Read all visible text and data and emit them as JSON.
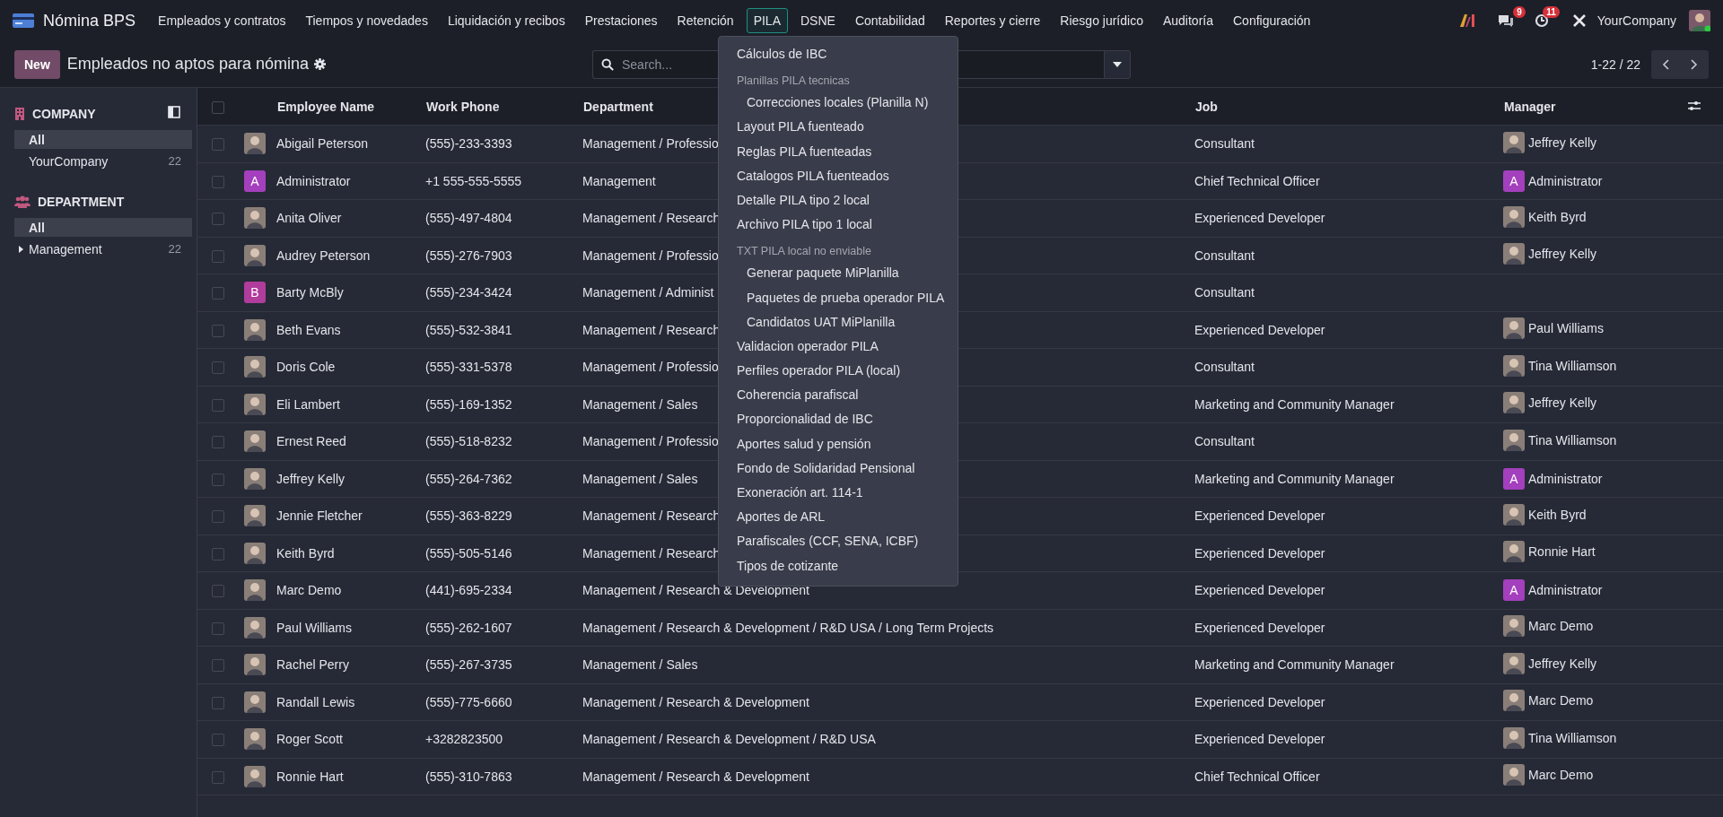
{
  "navbar": {
    "app_name": "Nómina BPS",
    "menus": [
      {
        "label": "Empleados y contratos",
        "selected": false
      },
      {
        "label": "Tiempos y novedades",
        "selected": false
      },
      {
        "label": "Liquidación y recibos",
        "selected": false
      },
      {
        "label": "Prestaciones",
        "selected": false
      },
      {
        "label": "Retención",
        "selected": false
      },
      {
        "label": "PILA",
        "selected": true
      },
      {
        "label": "DSNE",
        "selected": false
      },
      {
        "label": "Contabilidad",
        "selected": false
      },
      {
        "label": "Reportes y cierre",
        "selected": false
      },
      {
        "label": "Riesgo jurídico",
        "selected": false
      },
      {
        "label": "Auditoría",
        "selected": false
      },
      {
        "label": "Configuración",
        "selected": false
      }
    ],
    "chat_count": "9",
    "activity_count": "11",
    "company": "YourCompany"
  },
  "control_panel": {
    "new_button": "New",
    "title": "Empleados no aptos para nómina",
    "search_placeholder": "Search...",
    "pager": "1-22 / 22"
  },
  "dropdown": {
    "items": [
      {
        "kind": "item",
        "label": "Cálculos de IBC"
      },
      {
        "kind": "header",
        "label": "Planillas PILA tecnicas"
      },
      {
        "kind": "subitem",
        "label": "Correcciones locales (Planilla N)"
      },
      {
        "kind": "item",
        "label": "Layout PILA fuenteado"
      },
      {
        "kind": "item",
        "label": "Reglas PILA fuenteadas"
      },
      {
        "kind": "item",
        "label": "Catalogos PILA fuenteados"
      },
      {
        "kind": "item",
        "label": "Detalle PILA tipo 2 local"
      },
      {
        "kind": "item",
        "label": "Archivo PILA tipo 1 local"
      },
      {
        "kind": "header",
        "label": "TXT PILA local no enviable"
      },
      {
        "kind": "subitem",
        "label": "Generar paquete MiPlanilla"
      },
      {
        "kind": "subitem",
        "label": "Paquetes de prueba operador PILA"
      },
      {
        "kind": "subitem",
        "label": "Candidatos UAT MiPlanilla"
      },
      {
        "kind": "item",
        "label": "Validacion operador PILA"
      },
      {
        "kind": "item",
        "label": "Perfiles operador PILA (local)"
      },
      {
        "kind": "item",
        "label": "Coherencia parafiscal"
      },
      {
        "kind": "item",
        "label": "Proporcionalidad de IBC"
      },
      {
        "kind": "item",
        "label": "Aportes salud y pensión"
      },
      {
        "kind": "item",
        "label": "Fondo de Solidaridad Pensional"
      },
      {
        "kind": "item",
        "label": "Exoneración art. 114-1"
      },
      {
        "kind": "item",
        "label": "Aportes de ARL"
      },
      {
        "kind": "item",
        "label": "Parafiscales (CCF, SENA, ICBF)"
      },
      {
        "kind": "item",
        "label": "Tipos de cotizante"
      }
    ]
  },
  "sidebar": {
    "sections": [
      {
        "kind": "company",
        "title": "COMPANY",
        "items": [
          {
            "label": "All",
            "selected": true,
            "expandable": false
          },
          {
            "label": "YourCompany",
            "count": "22",
            "selected": false,
            "expandable": false
          }
        ]
      },
      {
        "kind": "department",
        "title": "DEPARTMENT",
        "items": [
          {
            "label": "All",
            "selected": true,
            "expandable": false
          },
          {
            "label": "Management",
            "count": "22",
            "selected": false,
            "expandable": true
          }
        ]
      }
    ]
  },
  "table": {
    "all_checked": false,
    "columns": [
      "Employee Name",
      "Work Phone",
      "Department",
      "Job",
      "Manager"
    ],
    "rows": [
      {
        "checked": false,
        "name": "Abigail Peterson",
        "avatar": {
          "kind": "photo"
        },
        "phone": "(555)-233-3393",
        "department": "Management / Professio",
        "job": "Consultant",
        "manager": {
          "name": "Jeffrey Kelly",
          "avatar": {
            "kind": "photo"
          }
        }
      },
      {
        "checked": false,
        "name": "Administrator",
        "avatar": {
          "kind": "letter",
          "letter": "A",
          "color": "#a43fbd"
        },
        "phone": "+1 555-555-5555",
        "department": "Management",
        "job": "Chief Technical Officer",
        "manager": {
          "name": "Administrator",
          "avatar": {
            "kind": "letter",
            "letter": "A",
            "color": "#a43fbd"
          }
        }
      },
      {
        "checked": false,
        "name": "Anita Oliver",
        "avatar": {
          "kind": "photo"
        },
        "phone": "(555)-497-4804",
        "department": "Management / Research",
        "job": "Experienced Developer",
        "manager": {
          "name": "Keith Byrd",
          "avatar": {
            "kind": "photo"
          }
        }
      },
      {
        "checked": false,
        "name": "Audrey Peterson",
        "avatar": {
          "kind": "photo"
        },
        "phone": "(555)-276-7903",
        "department": "Management / Professio",
        "job": "Consultant",
        "manager": {
          "name": "Jeffrey Kelly",
          "avatar": {
            "kind": "photo"
          }
        }
      },
      {
        "checked": false,
        "name": "Barty McBly",
        "avatar": {
          "kind": "letter",
          "letter": "B",
          "color": "#b03c9c"
        },
        "phone": "(555)-234-3424",
        "department": "Management / Administ",
        "job": "Consultant"
      },
      {
        "checked": false,
        "name": "Beth Evans",
        "avatar": {
          "kind": "photo"
        },
        "phone": "(555)-532-3841",
        "department": "Management / Research",
        "job": "Experienced Developer",
        "manager": {
          "name": "Paul Williams",
          "avatar": {
            "kind": "photo"
          }
        }
      },
      {
        "checked": false,
        "name": "Doris Cole",
        "avatar": {
          "kind": "photo"
        },
        "phone": "(555)-331-5378",
        "department": "Management / Professio",
        "job": "Consultant",
        "manager": {
          "name": "Tina Williamson",
          "avatar": {
            "kind": "photo"
          }
        }
      },
      {
        "checked": false,
        "name": "Eli Lambert",
        "avatar": {
          "kind": "photo"
        },
        "phone": "(555)-169-1352",
        "department": "Management / Sales",
        "job": "Marketing and Community Manager",
        "manager": {
          "name": "Jeffrey Kelly",
          "avatar": {
            "kind": "photo"
          }
        }
      },
      {
        "checked": false,
        "name": "Ernest Reed",
        "avatar": {
          "kind": "photo"
        },
        "phone": "(555)-518-8232",
        "department": "Management / Professio",
        "job": "Consultant",
        "manager": {
          "name": "Tina Williamson",
          "avatar": {
            "kind": "photo"
          }
        }
      },
      {
        "checked": false,
        "name": "Jeffrey Kelly",
        "avatar": {
          "kind": "photo"
        },
        "phone": "(555)-264-7362",
        "department": "Management / Sales",
        "job": "Marketing and Community Manager",
        "manager": {
          "name": "Administrator",
          "avatar": {
            "kind": "letter",
            "letter": "A",
            "color": "#a43fbd"
          }
        }
      },
      {
        "checked": false,
        "name": "Jennie Fletcher",
        "avatar": {
          "kind": "photo"
        },
        "phone": "(555)-363-8229",
        "department": "Management / Research",
        "job": "Experienced Developer",
        "manager": {
          "name": "Keith Byrd",
          "avatar": {
            "kind": "photo"
          }
        }
      },
      {
        "checked": false,
        "name": "Keith Byrd",
        "avatar": {
          "kind": "photo"
        },
        "phone": "(555)-505-5146",
        "department": "Management / Research",
        "job": "Experienced Developer",
        "manager": {
          "name": "Ronnie Hart",
          "avatar": {
            "kind": "photo"
          }
        }
      },
      {
        "checked": false,
        "name": "Marc Demo",
        "avatar": {
          "kind": "photo"
        },
        "phone": "(441)-695-2334",
        "department": "Management / Research & Development",
        "job": "Experienced Developer",
        "manager": {
          "name": "Administrator",
          "avatar": {
            "kind": "letter",
            "letter": "A",
            "color": "#a43fbd"
          }
        }
      },
      {
        "checked": false,
        "name": "Paul Williams",
        "avatar": {
          "kind": "photo"
        },
        "phone": "(555)-262-1607",
        "department": "Management / Research & Development / R&D USA / Long Term Projects",
        "job": "Experienced Developer",
        "manager": {
          "name": "Marc Demo",
          "avatar": {
            "kind": "photo"
          }
        }
      },
      {
        "checked": false,
        "name": "Rachel Perry",
        "avatar": {
          "kind": "photo"
        },
        "phone": "(555)-267-3735",
        "department": "Management / Sales",
        "job": "Marketing and Community Manager",
        "manager": {
          "name": "Jeffrey Kelly",
          "avatar": {
            "kind": "photo"
          }
        }
      },
      {
        "checked": false,
        "name": "Randall Lewis",
        "avatar": {
          "kind": "photo"
        },
        "phone": "(555)-775-6660",
        "department": "Management / Research & Development",
        "job": "Experienced Developer",
        "manager": {
          "name": "Marc Demo",
          "avatar": {
            "kind": "photo"
          }
        }
      },
      {
        "checked": false,
        "name": "Roger Scott",
        "avatar": {
          "kind": "photo"
        },
        "phone": "+3282823500",
        "department": "Management / Research & Development / R&D USA",
        "job": "Experienced Developer",
        "manager": {
          "name": "Tina Williamson",
          "avatar": {
            "kind": "photo"
          }
        }
      },
      {
        "checked": false,
        "name": "Ronnie Hart",
        "avatar": {
          "kind": "photo"
        },
        "phone": "(555)-310-7863",
        "department": "Management / Research & Development",
        "job": "Chief Technical Officer",
        "manager": {
          "name": "Marc Demo",
          "avatar": {
            "kind": "photo"
          }
        }
      }
    ]
  }
}
